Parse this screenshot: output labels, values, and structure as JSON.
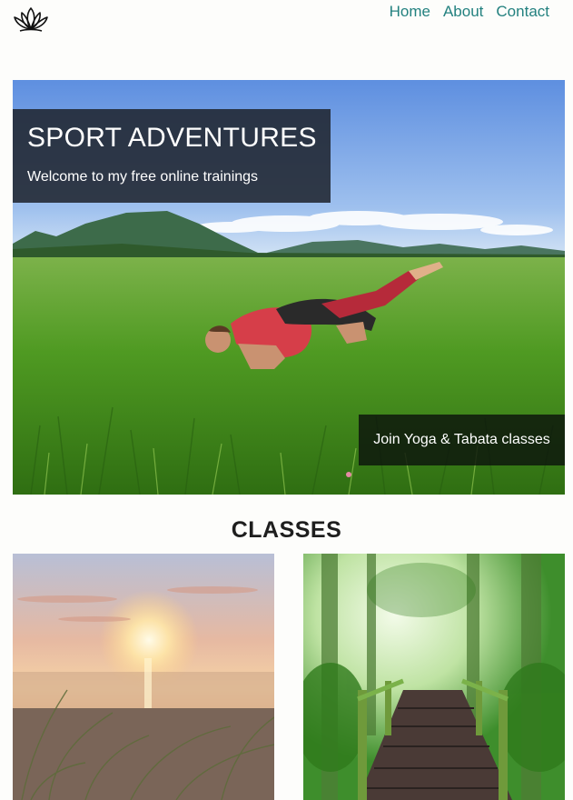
{
  "header": {
    "logo_icon": "lotus-icon",
    "nav": [
      {
        "label": "Home"
      },
      {
        "label": "About"
      },
      {
        "label": "Contact"
      }
    ]
  },
  "hero": {
    "title": "SPORT ADVENTURES",
    "subtitle": "Welcome to my free online trainings",
    "cta_label": "Join Yoga & Tabata classes",
    "image": "yoga-crow-pose-in-meadow"
  },
  "classes": {
    "title": "CLASSES",
    "cards": [
      {
        "image": "beach-sunset-with-dune-grass"
      },
      {
        "image": "forest-wooden-boardwalk"
      }
    ]
  },
  "colors": {
    "nav_link": "#23817f",
    "hero_overlay": "#202630",
    "cta_overlay": "#0c140c",
    "page_background": "#fdfdfb"
  }
}
